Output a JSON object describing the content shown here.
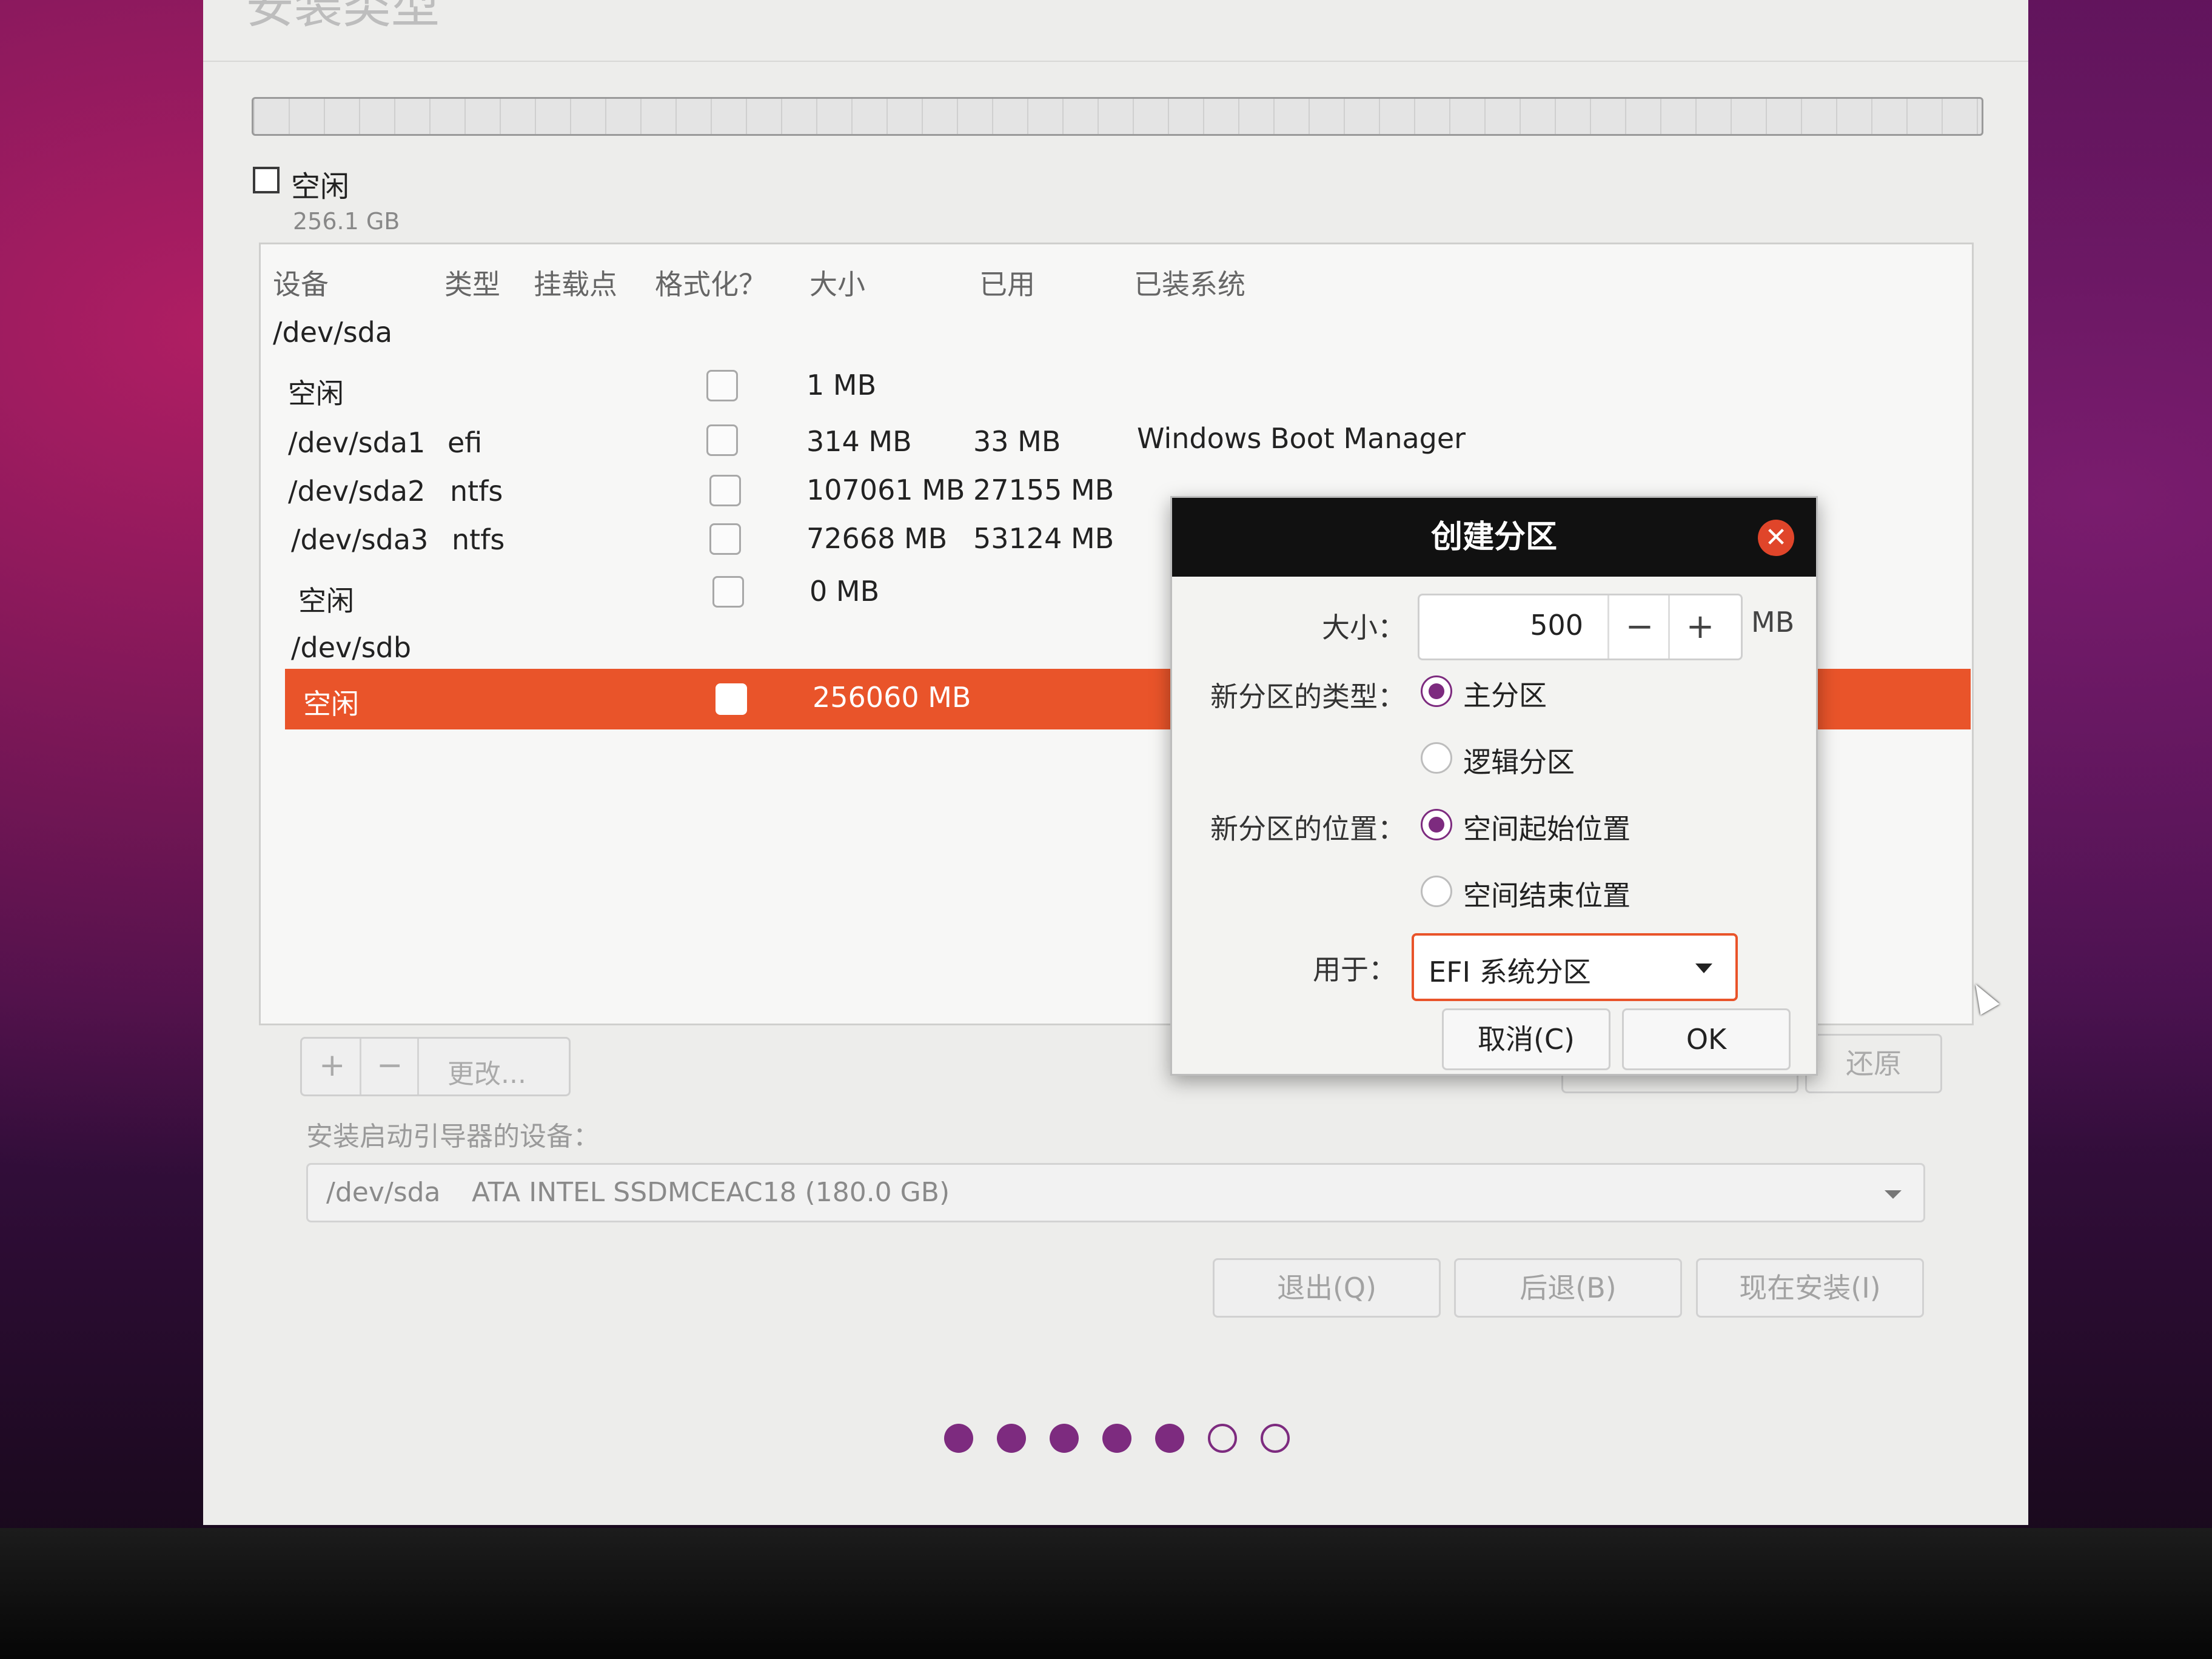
{
  "window": {
    "title": "安装类型"
  },
  "legend": {
    "label": "空闲",
    "size": "256.1 GB"
  },
  "table": {
    "headers": [
      "设备",
      "类型",
      "挂载点",
      "格式化？",
      "大小",
      "已用",
      "已装系统"
    ],
    "rows": [
      {
        "device": "/dev/sda"
      },
      {
        "device": "空闲",
        "size": "1 MB"
      },
      {
        "device": "/dev/sda1",
        "type": "efi",
        "size": "314 MB",
        "used": "33 MB",
        "system": "Windows Boot Manager"
      },
      {
        "device": "/dev/sda2",
        "type": "ntfs",
        "size": "107061 MB",
        "used": "27155 MB"
      },
      {
        "device": "/dev/sda3",
        "type": "ntfs",
        "size": "72668 MB",
        "used": "53124 MB"
      },
      {
        "device": "空闲",
        "size": "0 MB"
      },
      {
        "device": "/dev/sdb"
      },
      {
        "device": "空闲",
        "size": "256060 MB",
        "selected": true
      }
    ]
  },
  "toolbar": {
    "add": "+",
    "remove": "−",
    "change": "更改..."
  },
  "restore_label": "还原",
  "boot": {
    "label": "安装启动引导器的设备：",
    "device": "/dev/sda",
    "desc": "ATA INTEL SSDMCEAC18 (180.0 GB)"
  },
  "nav": {
    "quit": "退出(Q)",
    "back": "后退(B)",
    "install": "现在安装(I)"
  },
  "progress": {
    "total": 7,
    "completed": 5
  },
  "dialog": {
    "title": "创建分区",
    "size_label": "大小：",
    "size_value": "500",
    "minus": "−",
    "plus": "+",
    "unit": "MB",
    "type_label": "新分区的类型：",
    "type_primary": "主分区",
    "type_logical": "逻辑分区",
    "pos_label": "新分区的位置：",
    "pos_start": "空间起始位置",
    "pos_end": "空间结束位置",
    "use_label": "用于：",
    "use_value": "EFI 系统分区",
    "cancel": "取消(C)",
    "ok": "OK"
  },
  "colors": {
    "accent": "#e9542a",
    "purple": "#7d2b7f"
  }
}
